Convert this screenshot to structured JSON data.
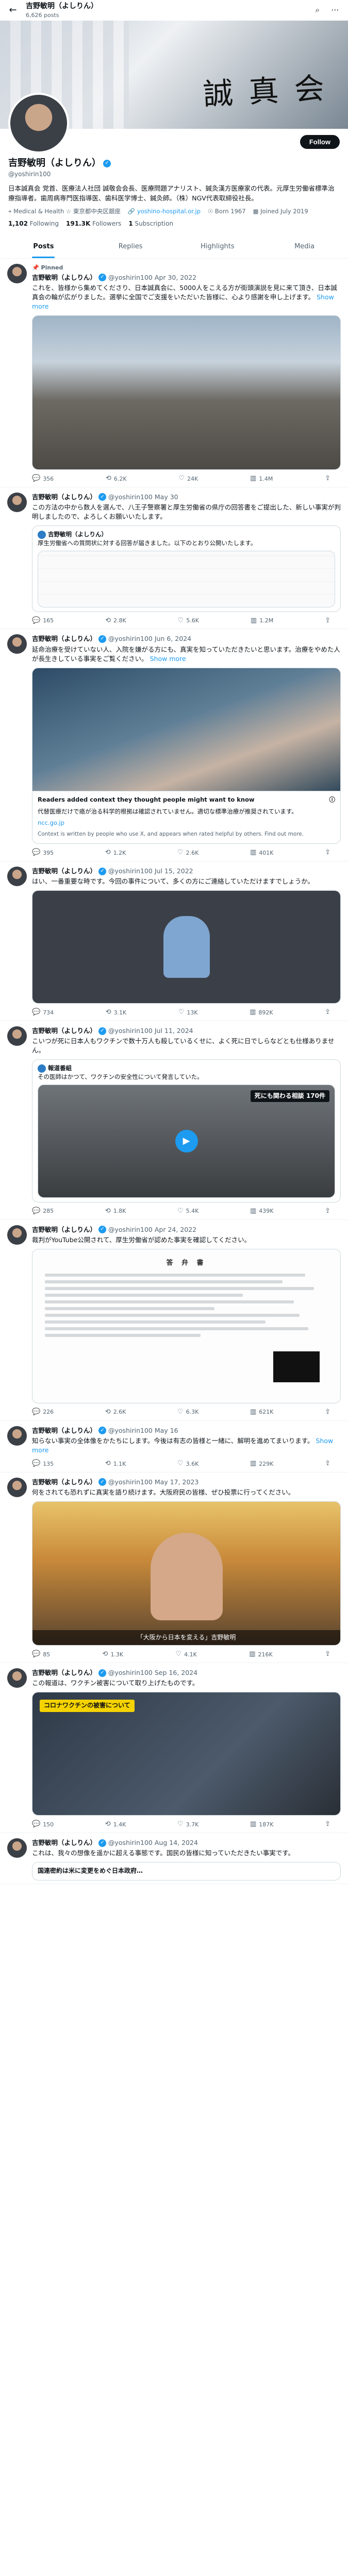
{
  "topbar": {
    "name": "吉野敏明（よしりん）",
    "posts_count": "6,626 posts"
  },
  "banner": {
    "calligraphy": "誠 真 会"
  },
  "profile": {
    "name": "吉野敏明（よしりん）",
    "handle": "@yoshirin100",
    "follow_label": "Follow",
    "bio": "日本誠真会 党首、医療法人社団 誠敬会会長、医療問題アナリスト、鍼灸漢方医療家の代表。元厚生労働省標準治療指導者。歯周病専門医指導医、歯科医学博士、鍼灸師。（株）NGV代表取締役社長。",
    "location": "Medical & Health ☆ 東京都中央区銀座",
    "link": "yoshino-hospital.or.jp",
    "born": "Born 1967",
    "joined": "Joined July 2019",
    "following_count": "1,102",
    "following_label": "Following",
    "followers_count": "191.3K",
    "followers_label": "Followers",
    "subscription_count": "1",
    "subscription_label": "Subscription"
  },
  "tabs": [
    "Posts",
    "Replies",
    "Highlights",
    "Media"
  ],
  "tweets": [
    {
      "pinned": "Pinned",
      "name": "吉野敏明（よしりん）",
      "handle": "@yoshirin100",
      "date": "Apr 30, 2022",
      "text": "これを、皆様から集めてくださり、日本誠真会に、5000人をこえる方が街頭演説を見に来て頂き、日本誠真会の輪が広がりました。選挙に全国でご支援をいただいた皆様に、心より感謝を申し上げます。",
      "more": "Show more",
      "replies": "356",
      "reposts": "6.2K",
      "likes": "24K",
      "views": "1.4M"
    },
    {
      "name": "吉野敏明（よしりん）",
      "handle": "@yoshirin100",
      "date": "May 30",
      "text": "この方法の中から数人を選んで、八王子警察署と厚生労働省の県庁の回答書をご提出した、新しい事実が判明しましたので、よろしくお願いいたします。",
      "quote_name": "吉野敏明（よしりん）",
      "quote_text": "厚生労働省への質問状に対する回答が届きました。以下のとおり公開いたします。",
      "replies": "165",
      "reposts": "2.8K",
      "likes": "5.6K",
      "views": "1.2M"
    },
    {
      "name": "吉野敏明（よしりん）",
      "handle": "@yoshirin100",
      "date": "Jun 6, 2024",
      "text": "延命治療を受けていない人、入院を嫌がる方にも、真実を知っていただきたいと思います。治療をやめた人が長生きしている事実をご覧ください。",
      "more": "Show more",
      "note_title": "Readers added context they thought people might want to know",
      "note_text": "代替医療だけで癌が治る科学的根拠は確認されていません。適切な標準治療が推奨されています。",
      "note_link": "ncc.go.jp",
      "note_footer": "Context is written by people who use X, and appears when rated helpful by others. Find out more.",
      "replies": "395",
      "reposts": "1.2K",
      "likes": "2.6K",
      "views": "401K"
    },
    {
      "name": "吉野敏明（よしりん）",
      "handle": "@yoshirin100",
      "date": "Jul 15, 2022",
      "text": "はい、一番重要な時です。今回の事件について、多くの方にご連絡していただけますでしょうか。",
      "replies": "734",
      "reposts": "3.1K",
      "likes": "13K",
      "views": "892K"
    },
    {
      "name": "吉野敏明（よしりん）",
      "handle": "@yoshirin100",
      "date": "Jul 11, 2024",
      "text": "こいつが死に日本人もワクチンで数十万人も殺しているくせに、よく死に日でしらなどとも仕様ありません。",
      "quote_name": "報道番組",
      "quote_text": "その医師はかつて、ワクチンの安全性について発言していた。",
      "video_caption": "死にも関わる相談 170件",
      "replies": "285",
      "reposts": "1.8K",
      "likes": "5.4K",
      "views": "439K"
    },
    {
      "name": "吉野敏明（よしりん）",
      "handle": "@yoshirin100",
      "date": "Apr 24, 2022",
      "text": "裁判がYouTube公開されて、厚生労働省が認めた事実を確認してください。",
      "doc_title": "答 弁 書",
      "replies": "226",
      "reposts": "2.6K",
      "likes": "6.3K",
      "views": "621K"
    },
    {
      "name": "吉野敏明（よしりん）",
      "handle": "@yoshirin100",
      "date": "May 16",
      "text": "知らない事実の全体像をかたちにします。今後は有志の皆様と一緒に、解明を進めてまいります。",
      "more": "Show more",
      "replies": "135",
      "reposts": "1.1K",
      "likes": "3.6K",
      "views": "229K"
    },
    {
      "name": "吉野敏明（よしりん）",
      "handle": "@yoshirin100",
      "date": "May 17, 2023",
      "text": "何をされても恐れずに真実を語り続けます。大阪府民の皆様、ぜひ投票に行ってください。",
      "video_caption": "「大阪から日本を変える」吉野敏明",
      "replies": "85",
      "reposts": "1.3K",
      "likes": "4.1K",
      "views": "216K"
    },
    {
      "name": "吉野敏明（よしりん）",
      "handle": "@yoshirin100",
      "date": "Sep 16, 2024",
      "text": "この報道は、ワクチン被害について取り上げたものです。",
      "img_caption": "コロナワクチンの被害について",
      "replies": "150",
      "reposts": "1.4K",
      "likes": "3.7K",
      "views": "187K"
    },
    {
      "name": "吉野敏明（よしりん）",
      "handle": "@yoshirin100",
      "date": "Aug 14, 2024",
      "text": "これは、我々の想像を遥かに超える事態です。国民の皆様に知っていただきたい事実です。",
      "link_preview": "国連密約は米に変更をめぐ日本政府…",
      "replies": "",
      "reposts": "",
      "likes": "",
      "views": ""
    }
  ]
}
